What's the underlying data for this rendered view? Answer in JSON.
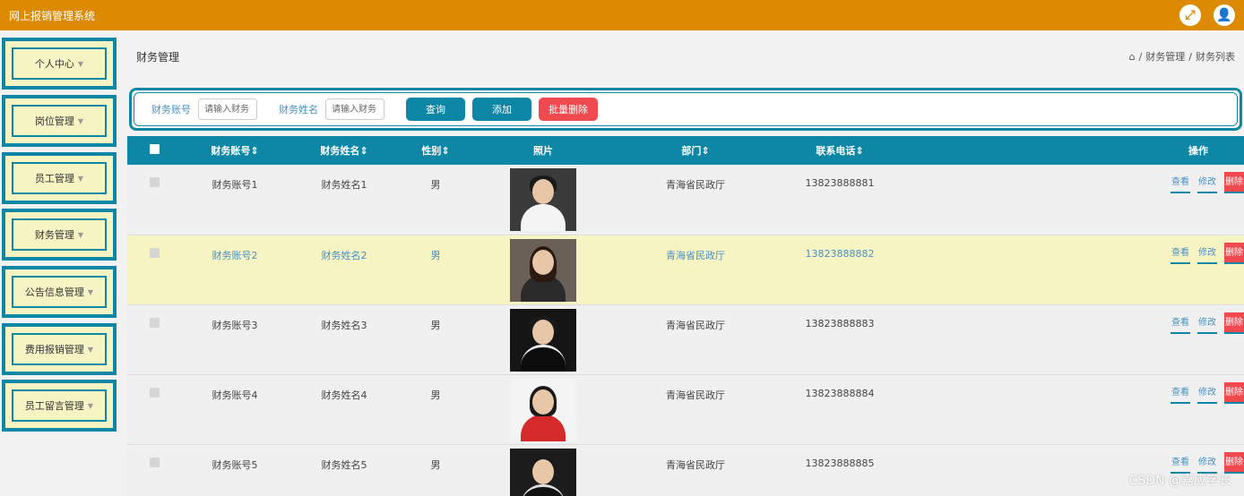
{
  "app": {
    "title": "网上报销管理系统",
    "icons": [
      "fullscreen-icon",
      "user-icon"
    ]
  },
  "sidebar": {
    "items": [
      {
        "label": "个人中心"
      },
      {
        "label": "岗位管理"
      },
      {
        "label": "员工管理"
      },
      {
        "label": "财务管理"
      },
      {
        "label": "公告信息管理"
      },
      {
        "label": "费用报销管理"
      },
      {
        "label": "员工留言管理"
      }
    ]
  },
  "page": {
    "title": "财务管理",
    "breadcrumb": [
      "财务管理",
      "财务列表"
    ]
  },
  "search": {
    "field1_label": "财务账号",
    "field1_placeholder": "请输入财务",
    "field2_label": "财务姓名",
    "field2_placeholder": "请输入财务",
    "query_label": "查询",
    "add_label": "添加",
    "batch_delete_label": "批量删除"
  },
  "table": {
    "headers": [
      "财务账号",
      "财务姓名",
      "性别",
      "照片",
      "部门",
      "联系电话",
      "操作"
    ],
    "actions": {
      "view": "查看",
      "edit": "修改",
      "delete": "删除"
    },
    "rows": [
      {
        "account": "财务账号1",
        "name": "财务姓名1",
        "gender": "男",
        "dept": "青海省民政厅",
        "phone": "13823888881"
      },
      {
        "account": "财务账号2",
        "name": "财务姓名2",
        "gender": "男",
        "dept": "青海省民政厅",
        "phone": "13823888882"
      },
      {
        "account": "财务账号3",
        "name": "财务姓名3",
        "gender": "男",
        "dept": "青海省民政厅",
        "phone": "13823888883"
      },
      {
        "account": "财务账号4",
        "name": "财务姓名4",
        "gender": "男",
        "dept": "青海省民政厅",
        "phone": "13823888884"
      },
      {
        "account": "财务账号5",
        "name": "财务姓名5",
        "gender": "男",
        "dept": "青海省民政厅",
        "phone": "13823888885"
      }
    ]
  },
  "watermark": "CSDN @嘉应学长",
  "colors": {
    "topbar": "#dc8a02",
    "accent": "#0e86a6",
    "danger": "#f0494f",
    "highlight": "#f7f4c4"
  }
}
